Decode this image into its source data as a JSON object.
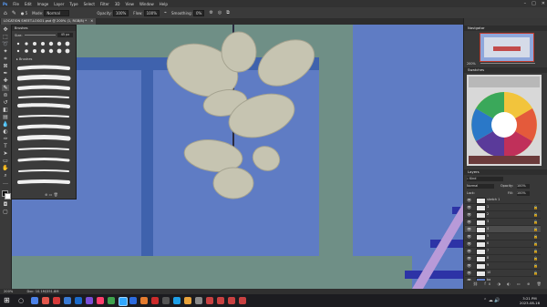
{
  "menu": {
    "items": [
      "File",
      "Edit",
      "Image",
      "Layer",
      "Type",
      "Select",
      "Filter",
      "3D",
      "View",
      "Window",
      "Help"
    ],
    "window_controls": {
      "minimize": "–",
      "maximize": "□",
      "close": "✕"
    }
  },
  "options": {
    "brush_size": "5",
    "mode_label": "Mode:",
    "mode_value": "Normal",
    "opacity_label": "Opacity:",
    "opacity_value": "100%",
    "flow_label": "Flow:",
    "flow_value": "100%",
    "smoothing_label": "Smoothing:",
    "smoothing_value": "0%"
  },
  "document": {
    "tab_title": "LOCATION SHEET-LOGO1.psd @ 200% (1, RGB/8) *",
    "tab_close": "✕"
  },
  "brushes_panel": {
    "title": "Brushes",
    "size_label": "Size:",
    "size_value": "45 px",
    "folder_label": "Brushes"
  },
  "navigator": {
    "title": "Navigator",
    "zoom": "200%"
  },
  "swatches": {
    "title": "Swatches"
  },
  "layers": {
    "title": "Layers",
    "filter_label": "Kind",
    "blend_mode": "Normal",
    "opacity_label": "Opacity:",
    "opacity_value": "100%",
    "lock_label": "Lock:",
    "fill_label": "Fill:",
    "fill_value": "100%",
    "rows": [
      {
        "name": "sketch 1"
      },
      {
        "name": "1"
      },
      {
        "name": "2"
      },
      {
        "name": "3"
      },
      {
        "name": "4"
      },
      {
        "name": "5"
      },
      {
        "name": "6"
      },
      {
        "name": "7"
      },
      {
        "name": "8"
      },
      {
        "name": "9"
      },
      {
        "name": "10"
      },
      {
        "name": "bg"
      }
    ]
  },
  "status": {
    "zoom": "200%",
    "doc_size": "Doc: 10.1M/351.8M"
  },
  "taskbar": {
    "time": "3:21 PM",
    "date": "2023-08-16"
  },
  "colors": {
    "canvas_bg": "#5f7cc4",
    "panel_bg": "#3b3b3b",
    "accent_green": "#6f8f86",
    "shape_fill": "#c6c4b1"
  }
}
